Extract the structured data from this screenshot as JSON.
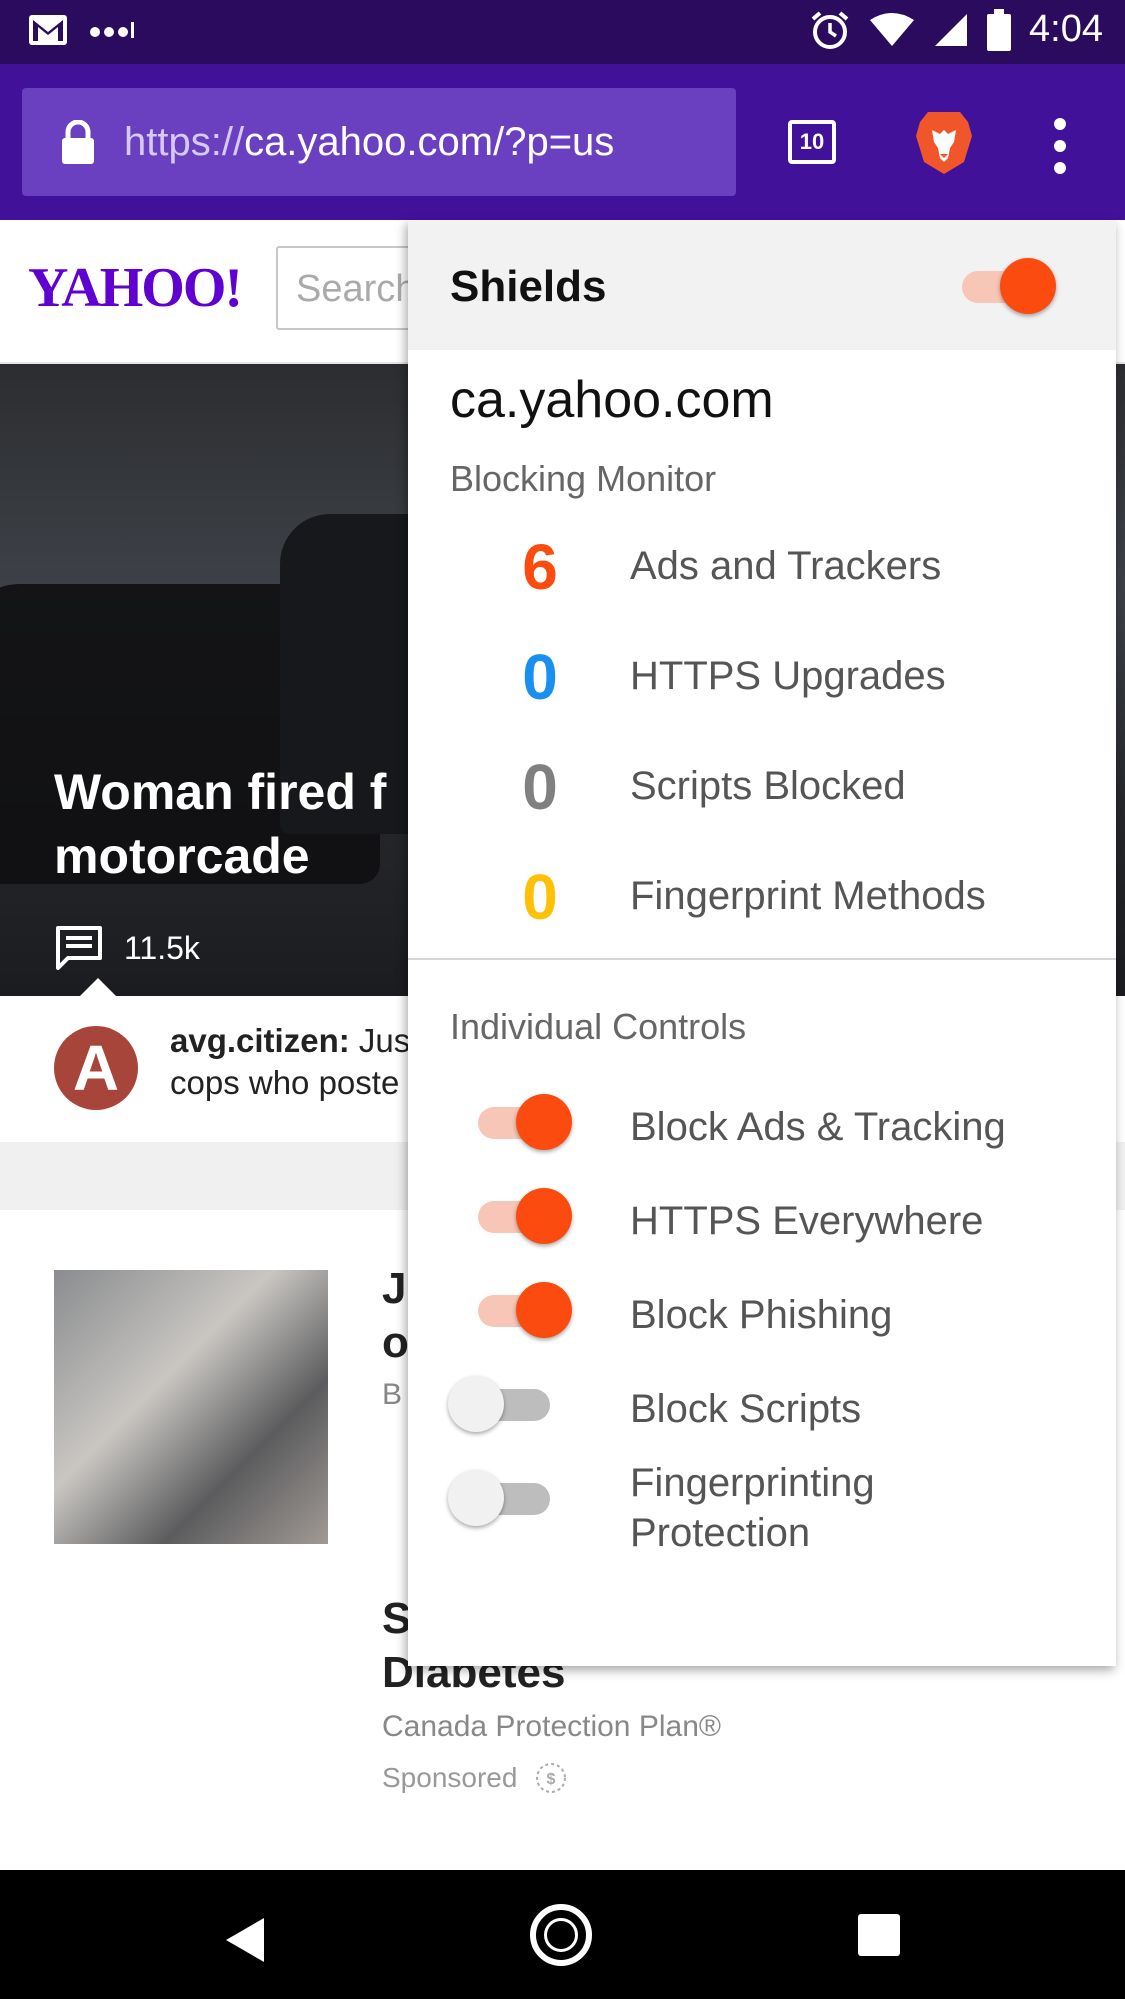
{
  "status_bar": {
    "time": "4:04"
  },
  "browser": {
    "url_prefix": "https://",
    "url_host": "ca.yahoo.com/?p=us",
    "tab_count": "10"
  },
  "page": {
    "logo": "YAHOO!",
    "search_placeholder": "Search",
    "hero_title_line1": "Woman fired f",
    "hero_title_line2": "motorcade",
    "hero_comment_count": "11.5k",
    "comment_user": "avg.citizen:",
    "comment_line1": "Jus",
    "comment_line2": "cops who poste",
    "avatar_letter": "A",
    "article1_line1": "J",
    "article1_line2": "o",
    "article1_source": "B",
    "article2_line1": "S",
    "article2_line2": "Diabetes",
    "article2_sponsor": "Canada Protection Plan®",
    "sponsored_label": "Sponsored"
  },
  "shields": {
    "title": "Shields",
    "enabled": true,
    "domain": "ca.yahoo.com",
    "monitor_label": "Blocking Monitor",
    "stats": [
      {
        "value": "6",
        "label": "Ads and Trackers",
        "color": "#fb4b0e"
      },
      {
        "value": "0",
        "label": "HTTPS Upgrades",
        "color": "#1a8ff2"
      },
      {
        "value": "0",
        "label": "Scripts Blocked",
        "color": "#808080"
      },
      {
        "value": "0",
        "label": "Fingerprint Methods",
        "color": "#ffc107"
      }
    ],
    "controls_label": "Individual Controls",
    "controls": [
      {
        "label": "Block Ads & Tracking",
        "on": true
      },
      {
        "label": "HTTPS Everywhere",
        "on": true
      },
      {
        "label": "Block Phishing",
        "on": true
      },
      {
        "label": "Block Scripts",
        "on": false
      },
      {
        "label_line1": "Fingerprinting",
        "label_line2": "Protection",
        "on": false
      }
    ]
  },
  "colors": {
    "status_bar": "#2b0b5e",
    "url_bar": "#42119a",
    "accent": "#fb4b0e",
    "yahoo_purple": "#5f01d1"
  }
}
